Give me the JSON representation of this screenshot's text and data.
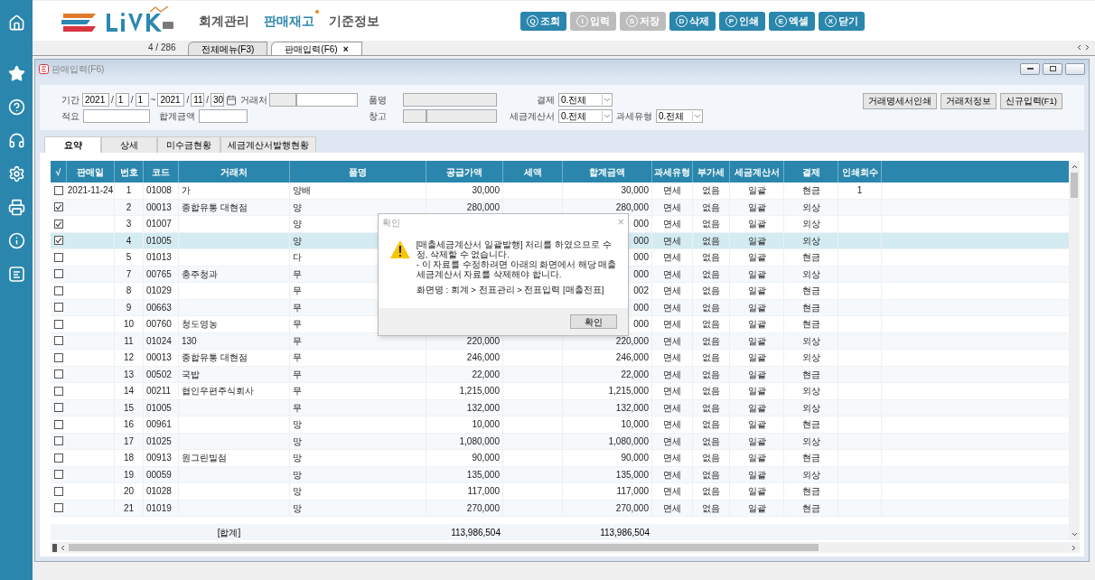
{
  "header": {
    "menus": [
      {
        "label": "회계관리",
        "selected": false
      },
      {
        "label": "판매재고",
        "selected": true
      },
      {
        "label": "기준정보",
        "selected": false
      }
    ],
    "buttons": [
      {
        "key": "Q",
        "label": "조회",
        "disabled": false
      },
      {
        "key": "I",
        "label": "입력",
        "disabled": true
      },
      {
        "key": "S",
        "label": "저장",
        "disabled": true
      },
      {
        "key": "D",
        "label": "삭제",
        "disabled": false
      },
      {
        "key": "P",
        "label": "인쇄",
        "disabled": false
      },
      {
        "key": "E",
        "label": "엑셀",
        "disabled": false
      },
      {
        "key": "X",
        "label": "닫기",
        "disabled": false
      }
    ]
  },
  "doc_tabs": {
    "counter": "4 / 286",
    "tabs": [
      {
        "label": "전체메뉴(F3)",
        "selected": false,
        "closable": false
      },
      {
        "label": "판매입력(F6)",
        "selected": true,
        "closable": true
      }
    ],
    "close": "×"
  },
  "window": {
    "title": "판매입력(F6)"
  },
  "filters": {
    "period_label": "기간",
    "from": [
      "2021",
      "1",
      "1"
    ],
    "sep": "/",
    "tilde": "~",
    "to": [
      "2021",
      "11",
      "30"
    ],
    "client_label": "거래처",
    "item_label": "품명",
    "payment_label": "결제",
    "payment": "0.전체",
    "memo_label": "적요",
    "amount_label": "합계금액",
    "warehouse_label": "창고",
    "invoice_label": "세금계산서",
    "invoice": "0.전체",
    "taxtype_label": "과세유형",
    "taxtype": "0.전체",
    "actions": [
      "거래명세서인쇄",
      "거래처정보",
      "신규입력(F1)"
    ]
  },
  "tabs": [
    {
      "label": "요약",
      "selected": true
    },
    {
      "label": "상세",
      "selected": false
    },
    {
      "label": "미수금현황",
      "selected": false
    },
    {
      "label": "세금계산서발행현황",
      "selected": false
    }
  ],
  "table": {
    "columns": [
      "√",
      "판매일",
      "번호",
      "코드",
      "거래처",
      "품명",
      "공급가액",
      "세액",
      "합계금액",
      "과세유형",
      "부가세",
      "세금계산서",
      "결제",
      "인쇄회수"
    ],
    "rows": [
      {
        "checked": false,
        "selected": false,
        "date": "2021-11-24",
        "no": "1",
        "code": "01008",
        "client": "가",
        "item": "양배",
        "supply": "30,000",
        "total": "30,000",
        "taxtype": "면세",
        "vat": "없음",
        "invoice": "일괄",
        "payment": "현금",
        "prints": "1"
      },
      {
        "checked": true,
        "selected": false,
        "no": "2",
        "code": "00013",
        "client": "종합유통 대현점",
        "item": "양",
        "supply": "280,000",
        "total": "280,000",
        "taxtype": "면세",
        "vat": "없음",
        "invoice": "일괄",
        "payment": "외상"
      },
      {
        "checked": true,
        "selected": false,
        "no": "3",
        "code": "01007",
        "item": "양",
        "total": "000",
        "taxtype": "면세",
        "vat": "없음",
        "invoice": "일괄",
        "payment": "외상"
      },
      {
        "checked": true,
        "selected": true,
        "no": "4",
        "code": "01005",
        "item": "양",
        "total": "000",
        "taxtype": "면세",
        "vat": "없음",
        "invoice": "일괄",
        "payment": "외상"
      },
      {
        "checked": false,
        "selected": false,
        "no": "5",
        "code": "01013",
        "item": "다",
        "total": "000",
        "taxtype": "면세",
        "vat": "없음",
        "invoice": "일괄",
        "payment": "현금"
      },
      {
        "checked": false,
        "selected": false,
        "no": "7",
        "code": "00765",
        "client": "충주청과",
        "item": "무",
        "total": "000",
        "taxtype": "면세",
        "vat": "없음",
        "invoice": "일괄",
        "payment": "외상"
      },
      {
        "checked": false,
        "selected": false,
        "no": "8",
        "code": "01029",
        "item": "무",
        "total": "002",
        "taxtype": "면세",
        "vat": "없음",
        "invoice": "일괄",
        "payment": "현금"
      },
      {
        "checked": false,
        "selected": false,
        "no": "9",
        "code": "00663",
        "item": "무",
        "total": "000",
        "taxtype": "면세",
        "vat": "없음",
        "invoice": "일괄",
        "payment": "현금"
      },
      {
        "checked": false,
        "selected": false,
        "no": "10",
        "code": "00760",
        "client": "청도영농",
        "item": "무",
        "total": "000",
        "taxtype": "면세",
        "vat": "없음",
        "invoice": "일괄",
        "payment": "현금"
      },
      {
        "checked": false,
        "selected": false,
        "no": "11",
        "code": "01024",
        "client": "130",
        "item": "무",
        "supply": "220,000",
        "total": "220,000",
        "taxtype": "면세",
        "vat": "없음",
        "invoice": "일괄",
        "payment": "외상"
      },
      {
        "checked": false,
        "selected": false,
        "no": "12",
        "code": "00013",
        "client": "종합유통 대현점",
        "item": "무",
        "supply": "246,000",
        "total": "246,000",
        "taxtype": "면세",
        "vat": "없음",
        "invoice": "일괄",
        "payment": "외상"
      },
      {
        "checked": false,
        "selected": false,
        "no": "13",
        "code": "00502",
        "client": "국밥",
        "item": "무",
        "supply": "22,000",
        "total": "22,000",
        "taxtype": "면세",
        "vat": "없음",
        "invoice": "일괄",
        "payment": "현금"
      },
      {
        "checked": false,
        "selected": false,
        "no": "14",
        "code": "00211",
        "client": "협인우편주식회사",
        "item": "무",
        "supply": "1,215,000",
        "total": "1,215,000",
        "taxtype": "면세",
        "vat": "없음",
        "invoice": "일괄",
        "payment": "외상"
      },
      {
        "checked": false,
        "selected": false,
        "no": "15",
        "code": "01005",
        "item": "무",
        "supply": "132,000",
        "total": "132,000",
        "taxtype": "면세",
        "vat": "없음",
        "invoice": "일괄",
        "payment": "외상"
      },
      {
        "checked": false,
        "selected": false,
        "no": "16",
        "code": "00961",
        "item": "망",
        "supply": "10,000",
        "total": "10,000",
        "taxtype": "면세",
        "vat": "없음",
        "invoice": "일괄",
        "payment": "현금"
      },
      {
        "checked": false,
        "selected": false,
        "no": "17",
        "code": "01025",
        "item": "망",
        "supply": "1,080,000",
        "total": "1,080,000",
        "taxtype": "면세",
        "vat": "없음",
        "invoice": "일괄",
        "payment": "외상"
      },
      {
        "checked": false,
        "selected": false,
        "no": "18",
        "code": "00913",
        "client": "원그린빌점",
        "item": "망",
        "supply": "90,000",
        "total": "90,000",
        "taxtype": "면세",
        "vat": "없음",
        "invoice": "일괄",
        "payment": "현금"
      },
      {
        "checked": false,
        "selected": false,
        "no": "19",
        "code": "00059",
        "item": "망",
        "supply": "135,000",
        "total": "135,000",
        "taxtype": "면세",
        "vat": "없음",
        "invoice": "일괄",
        "payment": "외상"
      },
      {
        "checked": false,
        "selected": false,
        "no": "20",
        "code": "01028",
        "item": "망",
        "supply": "117,000",
        "total": "117,000",
        "taxtype": "면세",
        "vat": "없음",
        "invoice": "일괄",
        "payment": "현금"
      },
      {
        "checked": false,
        "selected": false,
        "no": "21",
        "code": "01019",
        "item": "망",
        "supply": "270,000",
        "total": "270,000",
        "taxtype": "면세",
        "vat": "없음",
        "invoice": "일괄",
        "payment": "현금"
      }
    ],
    "summary": {
      "label": "[합계]",
      "supply": "113,986,504",
      "total": "113,986,504"
    }
  },
  "dialog": {
    "title": "확인",
    "close": "×",
    "message": [
      "[매출세금계산서 일괄발행] 처리를 하였으므로  수정, 삭제할 수 없습니다.",
      "- 이 자료를 수정하려면 아래의 화면에서 해당 매출세금계산서 자료를 삭제해야 합니다."
    ],
    "screen": "화면명 : 회계 > 전표관리 > 전표입력 [매출전표]",
    "ok": "확인"
  }
}
